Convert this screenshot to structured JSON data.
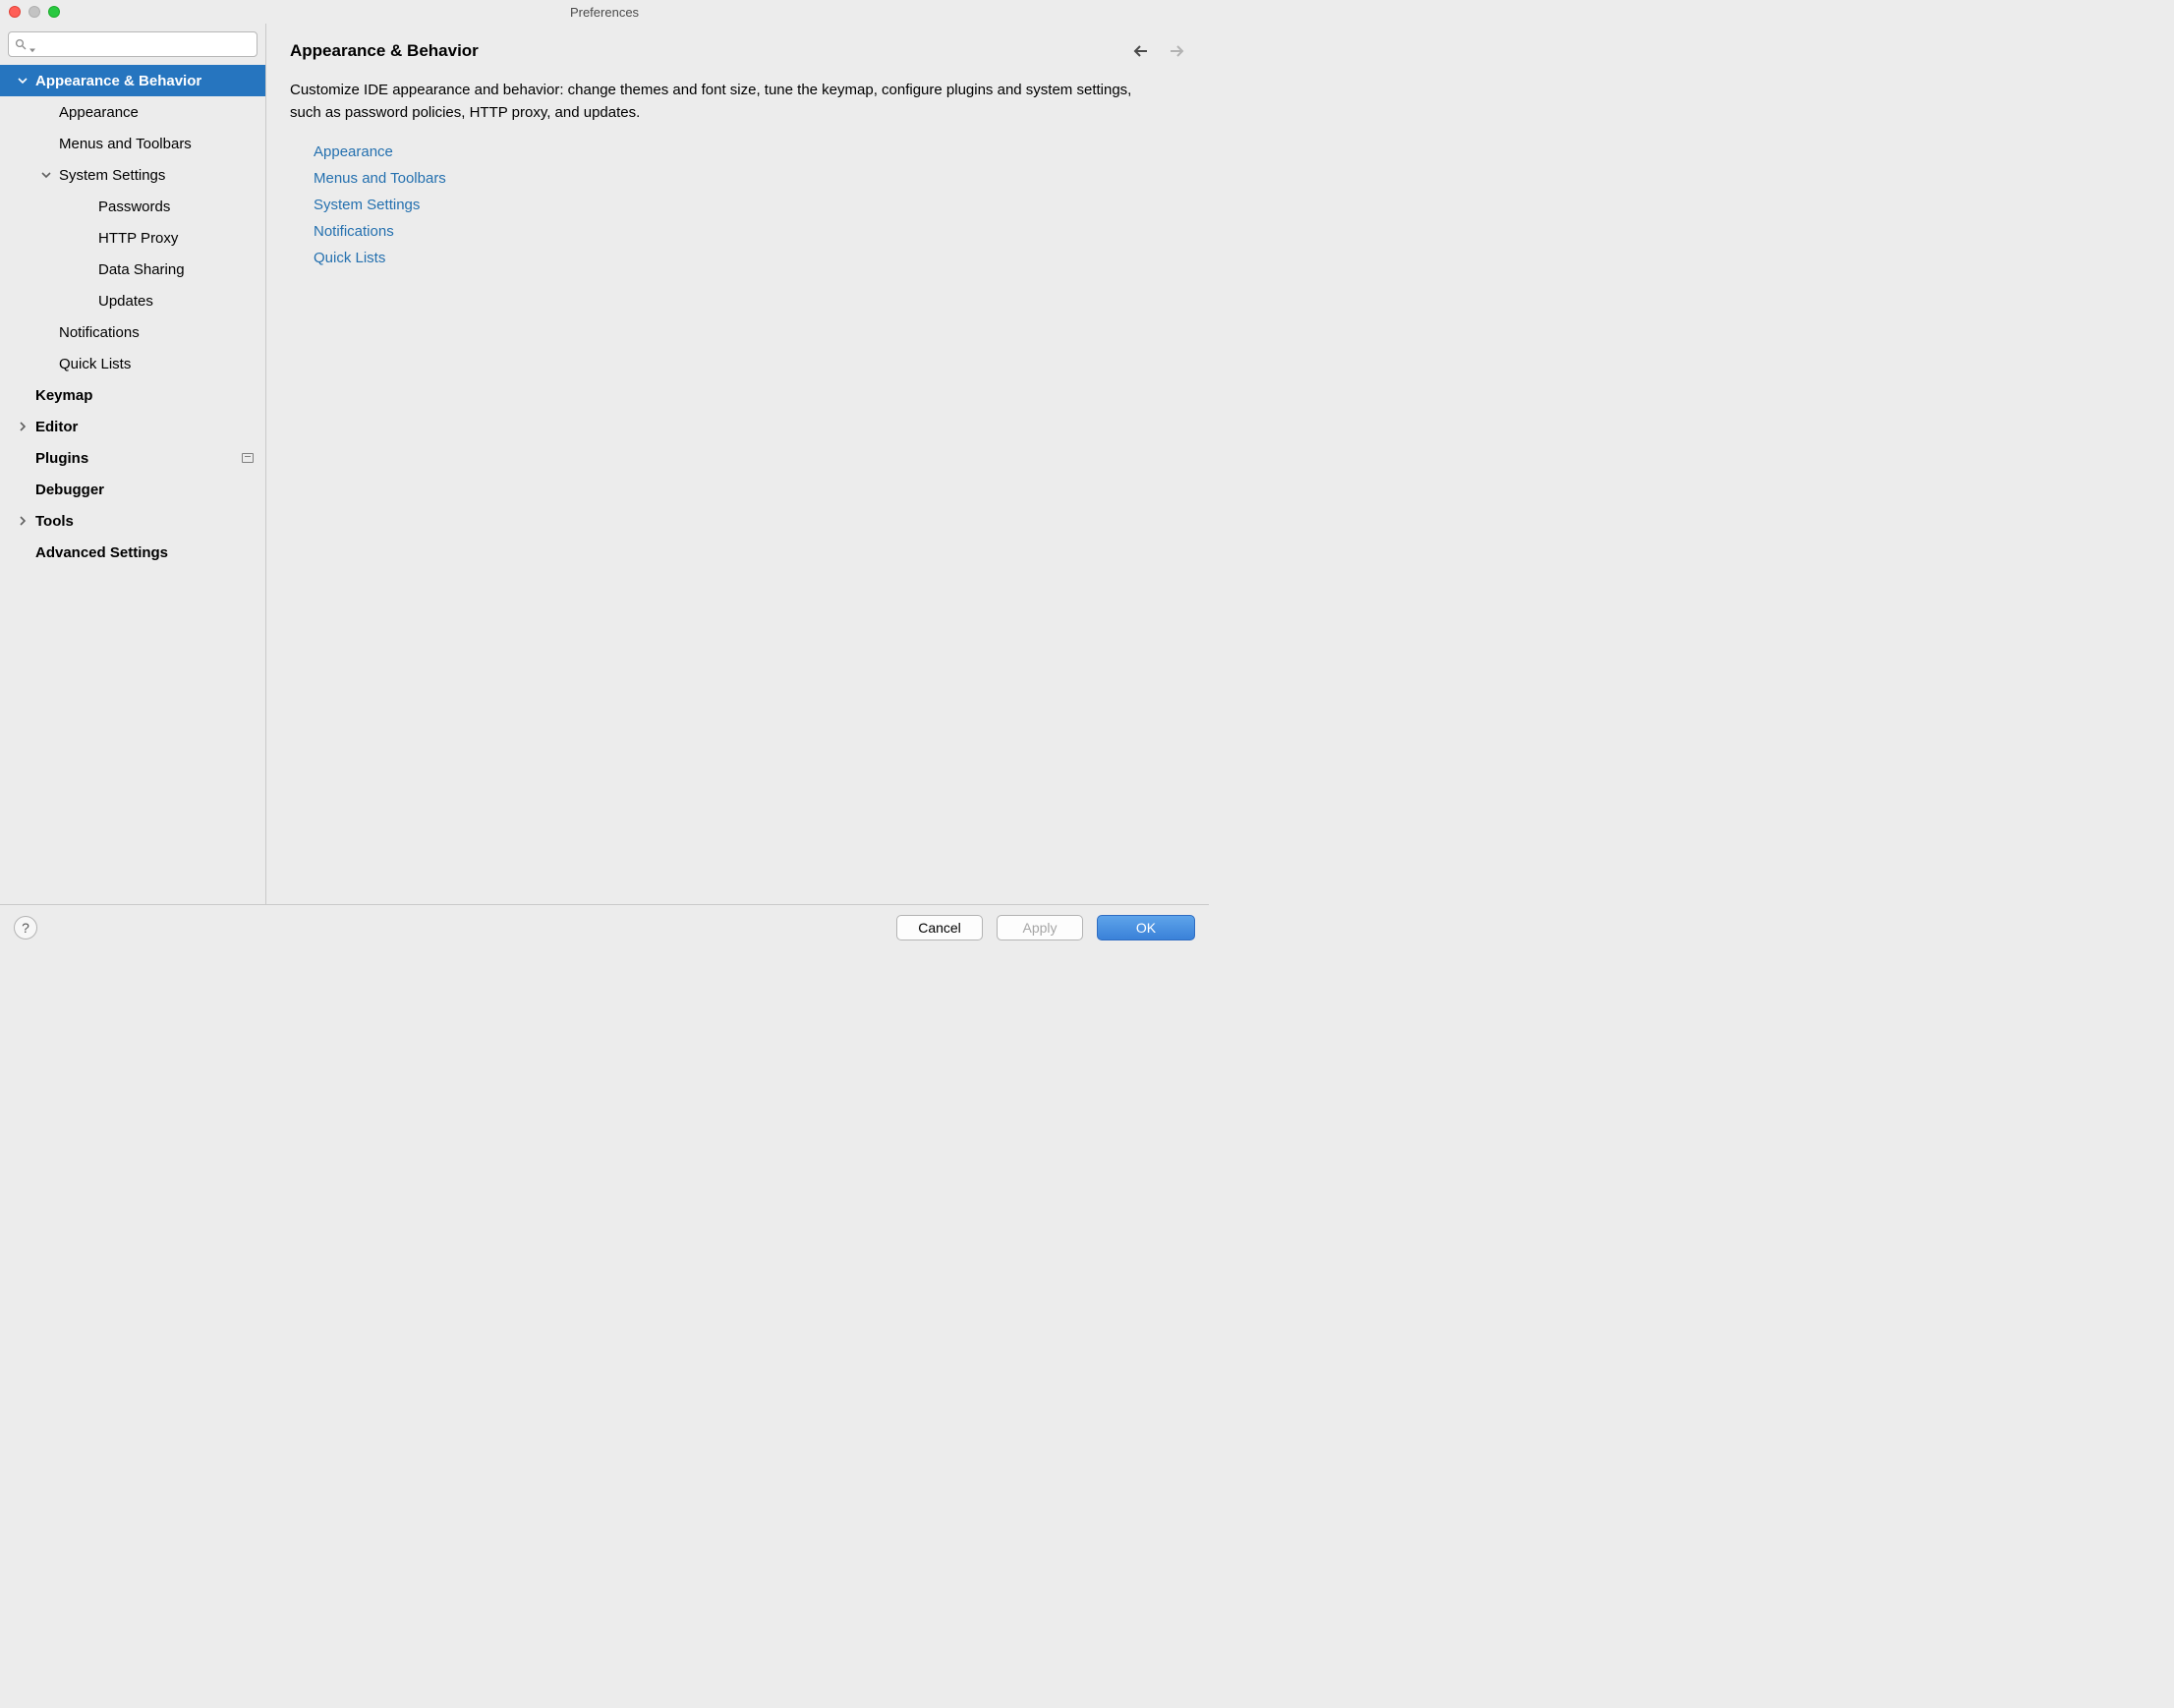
{
  "window": {
    "title": "Preferences"
  },
  "search": {
    "placeholder": ""
  },
  "sidebar": {
    "items": [
      {
        "label": "Appearance & Behavior",
        "level": 0,
        "bold": true,
        "selected": true,
        "arrow": "down"
      },
      {
        "label": "Appearance",
        "level": 1
      },
      {
        "label": "Menus and Toolbars",
        "level": 1
      },
      {
        "label": "System Settings",
        "level": 1,
        "arrow": "down"
      },
      {
        "label": "Passwords",
        "level": 2
      },
      {
        "label": "HTTP Proxy",
        "level": 2
      },
      {
        "label": "Data Sharing",
        "level": 2
      },
      {
        "label": "Updates",
        "level": 2
      },
      {
        "label": "Notifications",
        "level": 1
      },
      {
        "label": "Quick Lists",
        "level": 1
      },
      {
        "label": "Keymap",
        "level": 0,
        "bold": true
      },
      {
        "label": "Editor",
        "level": 0,
        "bold": true,
        "arrow": "right"
      },
      {
        "label": "Plugins",
        "level": 0,
        "bold": true,
        "badge": true
      },
      {
        "label": "Debugger",
        "level": 0,
        "bold": true
      },
      {
        "label": "Tools",
        "level": 0,
        "bold": true,
        "arrow": "right"
      },
      {
        "label": "Advanced Settings",
        "level": 0,
        "bold": true
      }
    ]
  },
  "content": {
    "title": "Appearance & Behavior",
    "description": "Customize IDE appearance and behavior: change themes and font size, tune the keymap, configure plugins and system settings, such as password policies, HTTP proxy, and updates.",
    "links": [
      "Appearance",
      "Menus and Toolbars",
      "System Settings",
      "Notifications",
      "Quick Lists"
    ],
    "nav_back_enabled": true,
    "nav_forward_enabled": false
  },
  "footer": {
    "help": "?",
    "cancel": "Cancel",
    "apply": "Apply",
    "ok": "OK",
    "apply_enabled": false
  }
}
